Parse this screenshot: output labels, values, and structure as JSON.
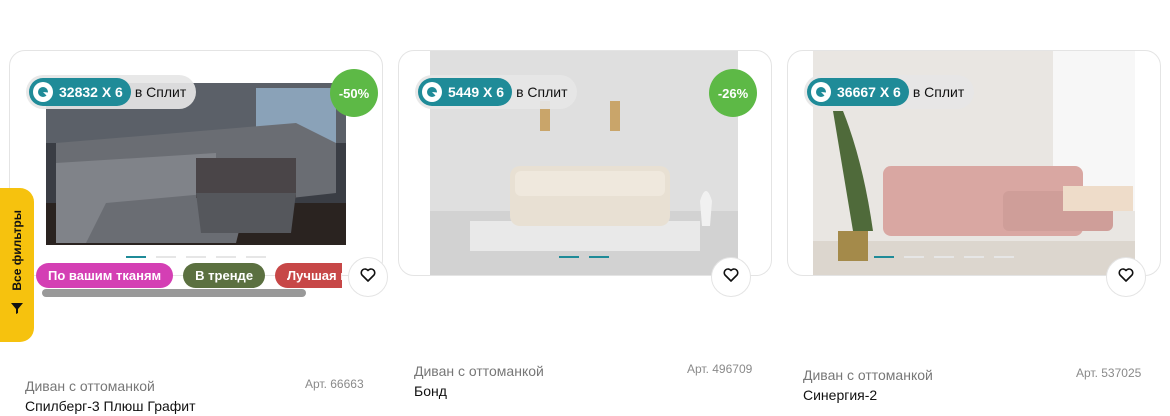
{
  "filters_tab": {
    "label": "Все фильтры"
  },
  "products": [
    {
      "split_amount": "32832 Х 6",
      "split_label": "в Сплит",
      "discount": "-50%",
      "tags": [
        "По вашим тканям",
        "В тренде",
        "Лучшая цена"
      ],
      "category": "Диван с оттоманкой",
      "article": "Арт. 66663",
      "name": "Спилберг-3 Плюш Графит",
      "photo_count": 5
    },
    {
      "split_amount": "5449 Х 6",
      "split_label": "в Сплит",
      "discount": "-26%",
      "tags": [],
      "category": "Диван с оттоманкой",
      "article": "Арт. 496709",
      "name": "Бонд",
      "photo_count": 2
    },
    {
      "split_amount": "36667 Х 6",
      "split_label": "в Сплит",
      "discount": "",
      "tags": [],
      "category": "Диван с оттоманкой",
      "article": "Арт. 537025",
      "name": "Синергия-2",
      "photo_count": 5
    }
  ],
  "colors": {
    "split": "#1f8b98",
    "discount": "#5db946",
    "filters": "#f6c20e"
  }
}
